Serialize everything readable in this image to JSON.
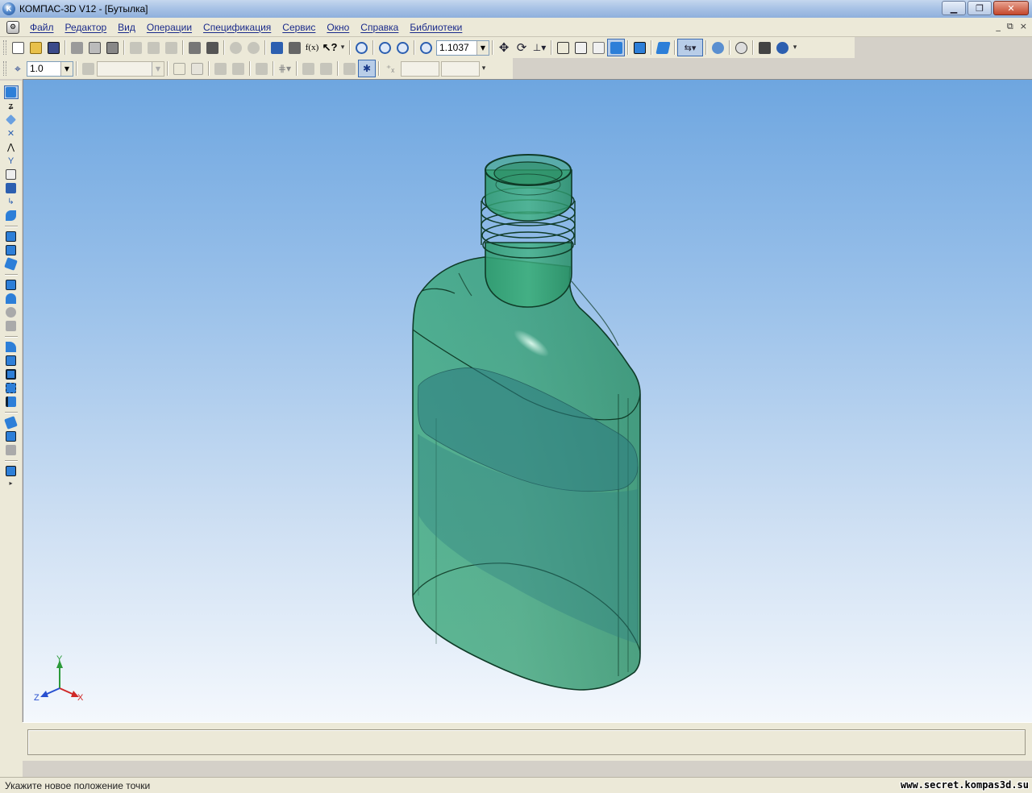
{
  "window": {
    "title": "КОМПАС-3D V12 - [Бутылка]",
    "icon": "kompas-logo-icon",
    "controls": [
      "minimize-icon",
      "restore-icon",
      "close-icon"
    ]
  },
  "menubar": {
    "items": [
      "Файл",
      "Редактор",
      "Вид",
      "Операции",
      "Спецификация",
      "Сервис",
      "Окно",
      "Справка",
      "Библиотеки"
    ],
    "mdi_controls": [
      "_",
      "⧉",
      "×"
    ]
  },
  "toolbar_main": {
    "zoom_value": "1.1037",
    "buttons": [
      "new-document-icon",
      "open-icon",
      "save-icon",
      "print-icon",
      "print-preview-icon",
      "properties-icon",
      "cut-icon",
      "copy-icon",
      "paste-icon",
      "format-painter-icon",
      "variables-icon",
      "undo-icon",
      "redo-icon",
      "model-tree-icon",
      "manager-icon",
      "fx-variables-icon",
      "help-cursor-icon",
      "zoom-window-icon",
      "zoom-in-icon",
      "zoom-out-icon",
      "zoom-scale-icon",
      "pan-icon",
      "rotate-icon",
      "orientation-icon",
      "wireframe-icon",
      "hidden-lines-icon",
      "hidden-lines-thin-icon",
      "halftone-icon",
      "halftone-edges-icon",
      "perspective-icon",
      "filter-icon",
      "snap-icon",
      "library-manager-icon",
      "extra-view-icon",
      "refresh-icon"
    ]
  },
  "toolbar_current": {
    "step_value": "1.0",
    "style_value": "",
    "coord_x": "",
    "coord_y": ""
  },
  "statusbar": {
    "message": "Укажите новое положение точки",
    "watermark": "www.secret.kompas3d.su"
  },
  "viewport": {
    "background_top": "#6ea6e0",
    "background_bottom": "#f4f8fd",
    "model_color": "#3aa87a",
    "axes": {
      "x": "X",
      "y": "Y",
      "z": "Z"
    }
  }
}
